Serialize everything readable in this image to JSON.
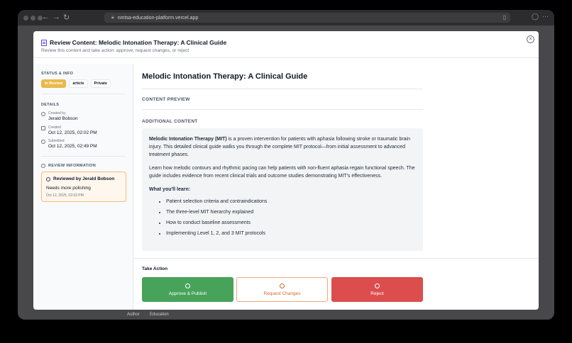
{
  "browser": {
    "url": "nmtsa-education-platform.vercel.app",
    "nav_back": "←",
    "nav_forward": "→",
    "reload": "↻"
  },
  "background": {
    "tabs": [
      "Author",
      "Education"
    ]
  },
  "modal": {
    "title": "Review Content: Melodic Intonation Therapy: A Clinical Guide",
    "subtitle": "Review this content and take action: approve, request changes, or reject",
    "close_icon": "×"
  },
  "sidebar": {
    "status_label": "STATUS & INFO",
    "badges": [
      "In Review",
      "article",
      "Private"
    ],
    "details_label": "DETAILS",
    "created_by_label": "Created by",
    "created_by": "Jerald Bobson",
    "created_label": "Created",
    "created": "Oct 12, 2025, 02:02 PM",
    "submitted_label": "Submitted",
    "submitted": "Oct 12, 2025, 02:49 PM",
    "review_label": "REVIEW INFORMATION",
    "review": {
      "reviewed_by": "Reviewed by Jerald Bobson",
      "message": "Needs more polishing",
      "date": "Oct 12, 2025, 02:03 PM"
    }
  },
  "main": {
    "title": "Melodic Intonation Therapy: A Clinical Guide",
    "preview_label": "CONTENT PREVIEW",
    "additional_label": "ADDITIONAL CONTENT",
    "content": {
      "p1_bold": "Melodic Intonation Therapy (MIT)",
      "p1_rest": " is a proven intervention for patients with aphasia following stroke or traumatic brain injury. This detailed clinical guide walks you through the complete MIT protocol—from initial assessment to advanced treatment phases.",
      "p2": "Learn how melodic contours and rhythmic pacing can help patients with non-fluent aphasia regain functional speech. The guide includes evidence from recent clinical trials and outcome studies demonstrating MIT's effectiveness.",
      "learn_heading": "What you'll learn:",
      "learn_items": [
        "Patient selection criteria and contraindications",
        "The three-level MIT hierarchy explained",
        "How to conduct baseline assessments",
        "Implementing Level 1, 2, and 3 MIT protocols"
      ]
    }
  },
  "actions": {
    "label": "Take Action",
    "approve": "Approve & Publish",
    "request": "Request Changes",
    "reject": "Reject"
  },
  "colors": {
    "approve": "#47a35a",
    "reject": "#dc4d4d",
    "request_border": "#f0a877",
    "in_review": "#e9b949"
  }
}
